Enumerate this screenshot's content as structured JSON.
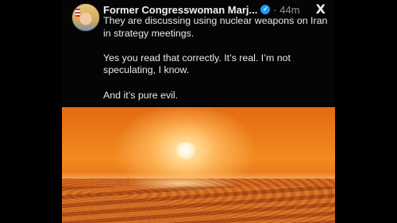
{
  "post": {
    "display_name": "Former Congresswoman Marj...",
    "timestamp": "44m",
    "platform_logo": "X",
    "paragraphs": [
      "They are discussing using nuclear weapons on Iran in strategy meetings.",
      "Yes you read that correctly.  It’s real.  I’m not speculating, I know.",
      "And it’s pure evil."
    ]
  },
  "icons": {
    "verified": "verified-badge-icon",
    "logo": "x-logo-icon"
  },
  "colors": {
    "background": "#000000",
    "text": "#e7e9ea",
    "muted": "#8b98a5",
    "verified": "#1d9bf0",
    "media_orange": "#e36a12"
  }
}
